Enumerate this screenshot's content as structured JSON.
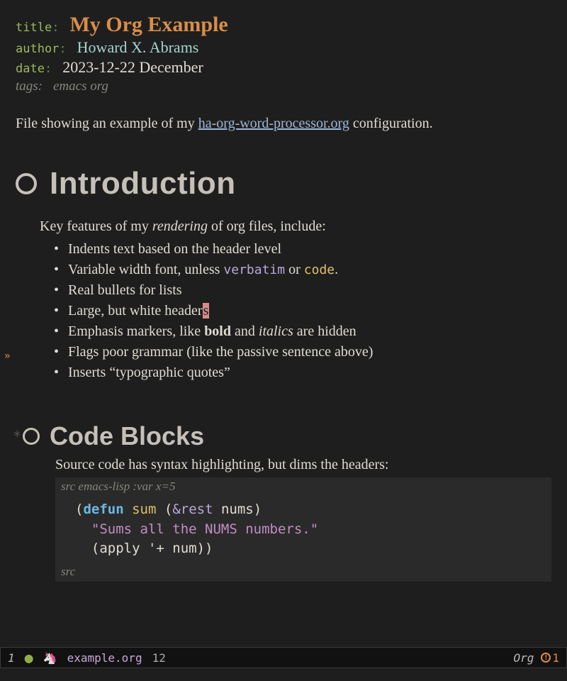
{
  "meta": {
    "title_key": "title",
    "title_val": "My Org Example",
    "author_key": "author",
    "author_val": "Howard X. Abrams",
    "date_key": "date",
    "date_val": "2023-12-22 December",
    "tags_key": "tags:",
    "tags_val": "emacs org"
  },
  "intro_para_pre": "File showing an example of my ",
  "intro_link": "ha-org-word-processor.org",
  "intro_para_post": " configuration.",
  "h1": "Introduction",
  "features_lead_pre": "Key features of my ",
  "features_lead_em": "rendering",
  "features_lead_post": " of org files, include:",
  "bullets": {
    "b1": "Indents text based on the header level",
    "b2_pre": "Variable width font, unless ",
    "b2_verbatim": "verbatim",
    "b2_mid": " or ",
    "b2_code": "code",
    "b2_post": ".",
    "b3": "Real bullets for lists",
    "b4_pre": "Large, but white header",
    "b4_cursor": "s",
    "b5_pre": "Emphasis markers, like ",
    "b5_bold": "bold",
    "b5_mid": " and ",
    "b5_ital": "italics",
    "b5_post": " are hidden",
    "b6": "Flags poor grammar (like the passive sentence above)",
    "b7": "Inserts “typographic quotes”"
  },
  "h2": "Code Blocks",
  "h2_body": "Source code has syntax highlighting, but dims the headers:",
  "src": {
    "header": "src emacs-lisp :var x=5",
    "l1_open": "(",
    "l1_defun": "defun",
    "l1_sp1": " ",
    "l1_fn": "sum",
    "l1_sp2": " (",
    "l1_rest": "&rest",
    "l1_sp3": " nums)",
    "l2_pre": "  ",
    "l2_str": "\"Sums all the NUMS numbers.\"",
    "l3_pre": "  (apply '+ num))",
    "footer": "src"
  },
  "modeline": {
    "window": "1",
    "unicorn": "🦄",
    "file": "example.org",
    "line": "12",
    "mode": "Org",
    "warn_count": "1"
  }
}
